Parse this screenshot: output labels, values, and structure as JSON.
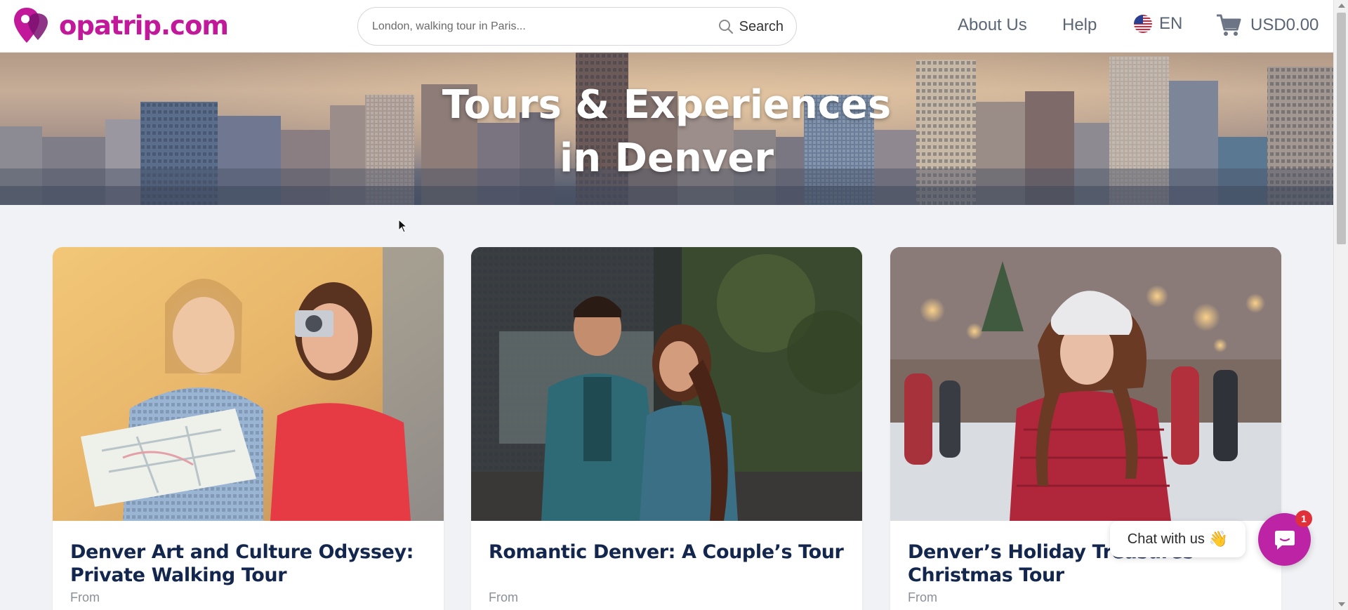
{
  "header": {
    "logo_text": "opatrip.com",
    "search_placeholder": "London, walking tour in Paris...",
    "search_label": "Search",
    "nav_about": "About Us",
    "nav_help": "Help",
    "language": "EN",
    "cart_total": "USD0.00"
  },
  "hero": {
    "title_line1": "Tours & Experiences",
    "title_line2": "in Denver"
  },
  "cards": [
    {
      "title": "Denver Art and Culture Odyssey: Private Walking Tour",
      "from_label": "From"
    },
    {
      "title": "Romantic Denver: A Couple’s Tour",
      "from_label": "From"
    },
    {
      "title": "Denver’s Holiday Treasures Christmas Tour",
      "from_label": "From"
    }
  ],
  "chat": {
    "label": "Chat with us",
    "wave_emoji": "👋",
    "badge_count": "1"
  },
  "colors": {
    "brand": "#c2189a",
    "chat_button": "#bc23a5",
    "card_title": "#13264d",
    "background": "#f1f2f5"
  }
}
